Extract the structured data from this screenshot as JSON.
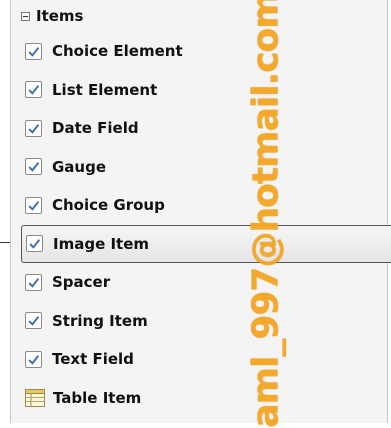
{
  "panel": {
    "header": {
      "label": "Items",
      "toggle_icon": "minus-toggle-icon"
    },
    "items": [
      {
        "label": "Choice Element",
        "icon": "checkbox-icon"
      },
      {
        "label": "List Element",
        "icon": "checkbox-icon"
      },
      {
        "label": "Date Field",
        "icon": "checkbox-icon"
      },
      {
        "label": "Gauge",
        "icon": "checkbox-icon"
      },
      {
        "label": "Choice Group",
        "icon": "checkbox-icon"
      },
      {
        "label": "Image Item",
        "icon": "checkbox-icon",
        "selected": true
      },
      {
        "label": "Spacer",
        "icon": "checkbox-icon"
      },
      {
        "label": "String Item",
        "icon": "checkbox-icon"
      },
      {
        "label": "Text Field",
        "icon": "checkbox-icon"
      },
      {
        "label": "Table Item",
        "icon": "table-icon"
      }
    ]
  },
  "watermark": {
    "text": "aml_997@hotmail.com",
    "color": "#f5a623"
  },
  "colors": {
    "check": "#3a6fb0",
    "selection_border": "#555555"
  }
}
